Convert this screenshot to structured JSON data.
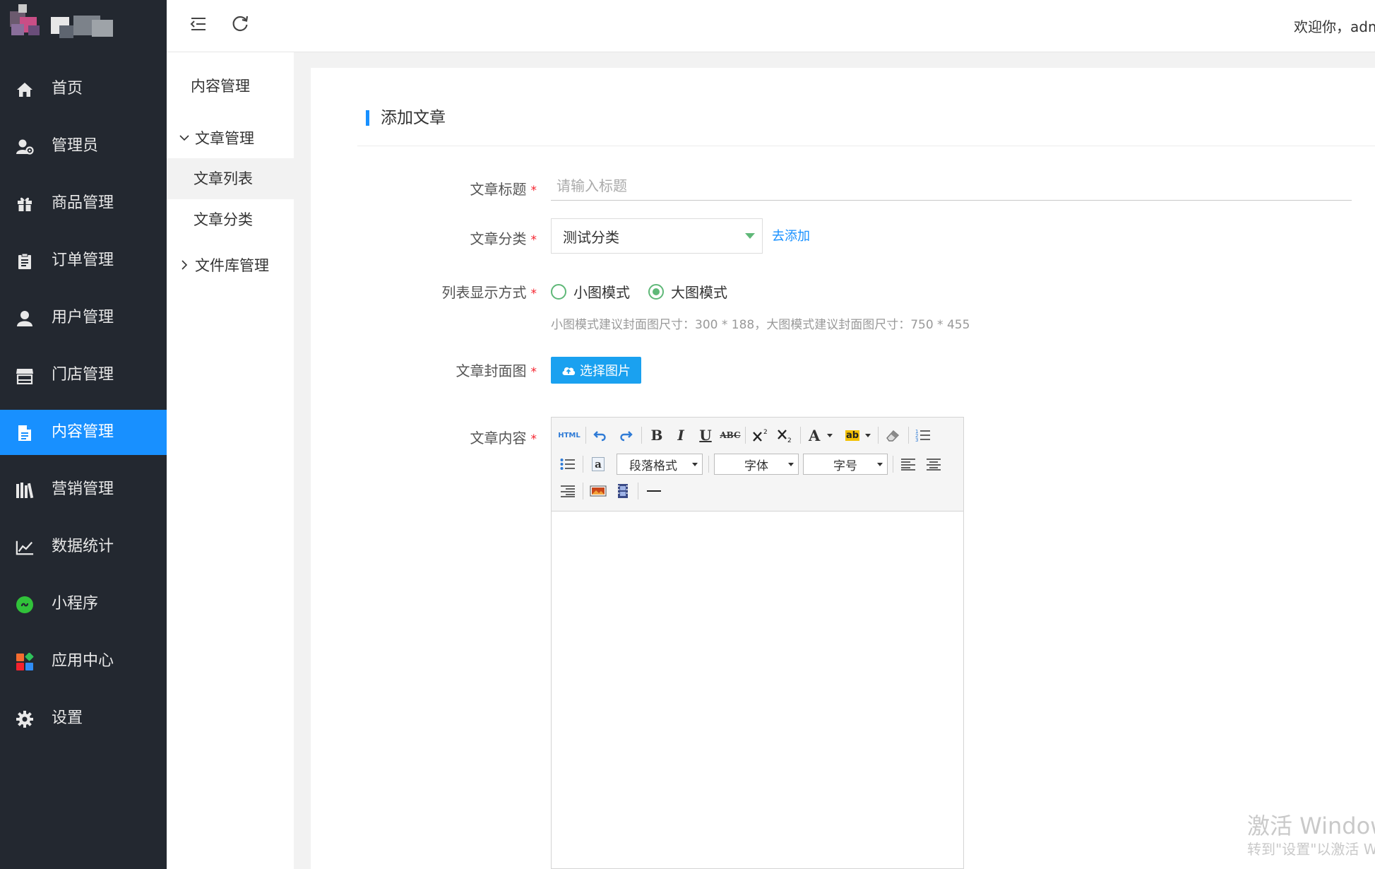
{
  "header": {
    "welcome": "欢迎你，admin"
  },
  "sidebar": {
    "items": [
      {
        "label": "首页",
        "icon": "home-icon"
      },
      {
        "label": "管理员",
        "icon": "admin-user-icon"
      },
      {
        "label": "商品管理",
        "icon": "gift-icon"
      },
      {
        "label": "订单管理",
        "icon": "clipboard-icon"
      },
      {
        "label": "用户管理",
        "icon": "user-icon"
      },
      {
        "label": "门店管理",
        "icon": "store-icon"
      },
      {
        "label": "内容管理",
        "icon": "document-icon",
        "active": true
      },
      {
        "label": "营销管理",
        "icon": "books-icon"
      },
      {
        "label": "数据统计",
        "icon": "chart-line-icon"
      },
      {
        "label": "小程序",
        "icon": "mini-program-icon"
      },
      {
        "label": "应用中心",
        "icon": "app-grid-icon"
      },
      {
        "label": "设置",
        "icon": "gear-icon"
      }
    ]
  },
  "submenu": {
    "title": "内容管理",
    "group1": "文章管理",
    "items": [
      "文章列表",
      "文章分类"
    ],
    "group2": "文件库管理"
  },
  "form": {
    "heading": "添加文章",
    "required_mark": "*",
    "title_label": "文章标题",
    "title_placeholder": "请输入标题",
    "title_value": "",
    "category_label": "文章分类",
    "category_value": "测试分类",
    "category_add": "去添加",
    "display_label": "列表显示方式",
    "display_options": [
      "小图模式",
      "大图模式"
    ],
    "display_selected": "大图模式",
    "display_hint": "小图模式建议封面图尺寸：300 * 188，大图模式建议封面图尺寸：750 * 455",
    "cover_label": "文章封面图",
    "cover_button": "选择图片",
    "content_label": "文章内容"
  },
  "editor": {
    "html_label": "HTML",
    "paragraph_label": "段落格式",
    "font_label": "字体",
    "fontsize_label": "字号",
    "anchor_label": "a",
    "font_color_label": "A",
    "highlight_label": "ab"
  },
  "watermark": {
    "line1": "激活 Windows",
    "line2": "转到\"设置\"以激活 Windows。"
  },
  "colors": {
    "sidebar_bg": "#232830",
    "accent": "#1890ff",
    "radio_green": "#5fb878",
    "required_red": "#f5222d",
    "upload_button": "#1aa1f0"
  }
}
